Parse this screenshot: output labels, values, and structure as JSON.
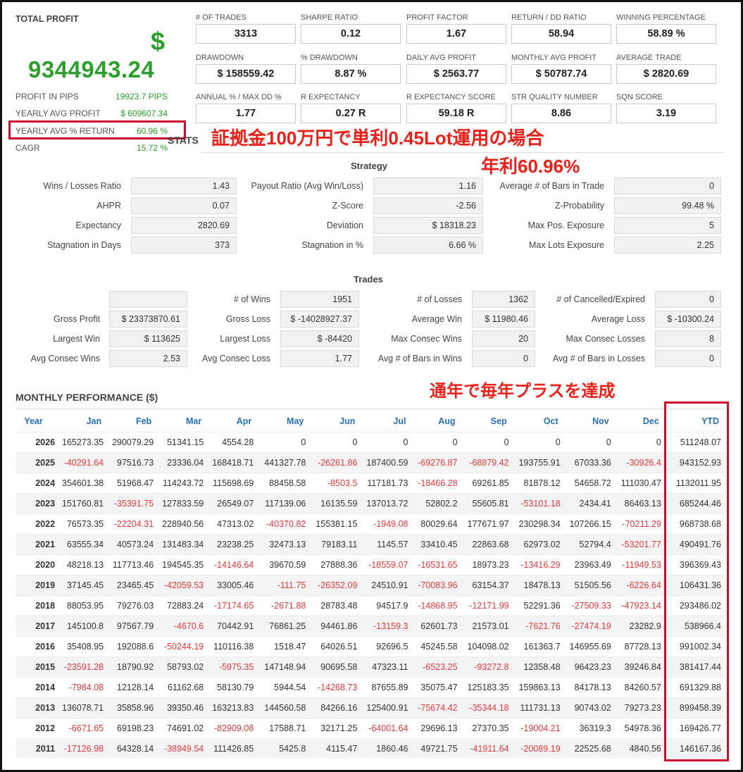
{
  "total_profit": {
    "title": "TOTAL PROFIT",
    "currency": "$",
    "value": "9344943.24",
    "rows": [
      {
        "label": "PROFIT IN PIPS",
        "value": "19923.7 PIPS"
      },
      {
        "label": "YEARLY AVG PROFIT",
        "value": "$ 609607.34"
      },
      {
        "label": "YEARLY AVG % RETURN",
        "value": "60.96 %"
      },
      {
        "label": "CAGR",
        "value": "15.72 %"
      }
    ]
  },
  "metrics": [
    {
      "label": "# OF TRADES",
      "value": "3313"
    },
    {
      "label": "SHARPE RATIO",
      "value": "0.12"
    },
    {
      "label": "PROFIT FACTOR",
      "value": "1.67"
    },
    {
      "label": "RETURN / DD RATIO",
      "value": "58.94"
    },
    {
      "label": "WINNING PERCENTAGE",
      "value": "58.89 %"
    },
    {
      "label": "DRAWDOWN",
      "value": "$ 158559.42"
    },
    {
      "label": "% DRAWDOWN",
      "value": "8.87 %"
    },
    {
      "label": "DAILY AVG PROFIT",
      "value": "$ 2563.77"
    },
    {
      "label": "MONTHLY AVG PROFIT",
      "value": "$ 50787.74"
    },
    {
      "label": "AVERAGE TRADE",
      "value": "$ 2820.69"
    },
    {
      "label": "ANNUAL % / MAX DD %",
      "value": "1.77"
    },
    {
      "label": "R EXPECTANCY",
      "value": "0.27 R"
    },
    {
      "label": "R EXPECTANCY SCORE",
      "value": "59.18 R"
    },
    {
      "label": "STR QUALITY NUMBER",
      "value": "8.86"
    },
    {
      "label": "SQN SCORE",
      "value": "3.19"
    }
  ],
  "stats_tag": "STATS",
  "annotations": {
    "margin_note": "証拠金100万円で単利0.45Lot運用の場合",
    "yearly_note": "年利60.96%",
    "every_year_note": "通年で毎年プラスを達成"
  },
  "strategy": {
    "title": "Strategy",
    "rows": [
      [
        {
          "label": "Wins / Losses Ratio",
          "value": "1.43"
        },
        {
          "label": "Payout Ratio (Avg Win/Loss)",
          "value": "1.16"
        },
        {
          "label": "Average # of Bars in Trade",
          "value": "0"
        }
      ],
      [
        {
          "label": "AHPR",
          "value": "0.07"
        },
        {
          "label": "Z-Score",
          "value": "-2.56"
        },
        {
          "label": "Z-Probability",
          "value": "99.48 %"
        }
      ],
      [
        {
          "label": "Expectancy",
          "value": "2820.69"
        },
        {
          "label": "Deviation",
          "value": "$ 18318.23"
        },
        {
          "label": "Max Pos. Exposure",
          "value": "5"
        }
      ],
      [
        {
          "label": "Stagnation in Days",
          "value": "373"
        },
        {
          "label": "Stagnation in %",
          "value": "6.66 %"
        },
        {
          "label": "Max Lots Exposure",
          "value": "2.25"
        }
      ]
    ]
  },
  "trades": {
    "title": "Trades",
    "rows": [
      [
        {
          "label": "",
          "value": ""
        },
        {
          "label": "# of Wins",
          "value": "1951"
        },
        {
          "label": "# of Losses",
          "value": "1362"
        },
        {
          "label": "# of Cancelled/Expired",
          "value": "0"
        }
      ],
      [
        {
          "label": "Gross Profit",
          "value": "$ 23373870.61"
        },
        {
          "label": "Gross Loss",
          "value": "$ -14028927.37"
        },
        {
          "label": "Average Win",
          "value": "$ 11980.46"
        },
        {
          "label": "Average Loss",
          "value": "$ -10300.24"
        }
      ],
      [
        {
          "label": "Largest Win",
          "value": "$ 113625"
        },
        {
          "label": "Largest Loss",
          "value": "$ -84420"
        },
        {
          "label": "Max Consec Wins",
          "value": "20"
        },
        {
          "label": "Max Consec Losses",
          "value": "8"
        }
      ],
      [
        {
          "label": "Avg Consec Wins",
          "value": "2.53"
        },
        {
          "label": "Avg Consec Loss",
          "value": "1.77"
        },
        {
          "label": "Avg # of Bars in Wins",
          "value": "0"
        },
        {
          "label": "Avg # of Bars in Losses",
          "value": "0"
        }
      ]
    ]
  },
  "monthly": {
    "title": "MONTHLY PERFORMANCE ($)",
    "headers": [
      "Year",
      "Jan",
      "Feb",
      "Mar",
      "Apr",
      "May",
      "Jun",
      "Jul",
      "Aug",
      "Sep",
      "Oct",
      "Nov",
      "Dec",
      "YTD"
    ],
    "rows": [
      [
        "2026",
        "165273.35",
        "290079.29",
        "51341.15",
        "4554.28",
        "0",
        "0",
        "0",
        "0",
        "0",
        "0",
        "0",
        "0",
        "511248.07"
      ],
      [
        "2025",
        "-40291.64",
        "97516.73",
        "23336.04",
        "168418.71",
        "441327.78",
        "-26261.86",
        "187400.59",
        "-69276.87",
        "-68879.42",
        "193755.91",
        "67033.36",
        "-30926.4",
        "943152.93"
      ],
      [
        "2024",
        "354601.38",
        "51968.47",
        "114243.72",
        "115698.69",
        "88458.58",
        "-8503.5",
        "117181.73",
        "-18466.28",
        "69261.85",
        "81878.12",
        "54658.72",
        "111030.47",
        "1132011.95"
      ],
      [
        "2023",
        "151760.81",
        "-35391.75",
        "127833.59",
        "26549.07",
        "117139.06",
        "16135.59",
        "137013.72",
        "52802.2",
        "55605.81",
        "-53101.18",
        "2434.41",
        "86463.13",
        "685244.46"
      ],
      [
        "2022",
        "76573.35",
        "-22204.31",
        "228940.56",
        "47313.02",
        "-40370.82",
        "155381.15",
        "-1949.08",
        "80029.64",
        "177671.97",
        "230298.34",
        "107266.15",
        "-70211.29",
        "968738.68"
      ],
      [
        "2021",
        "63555.34",
        "40573.24",
        "131483.34",
        "23238.25",
        "32473.13",
        "79183.11",
        "1145.57",
        "33410.45",
        "22863.68",
        "62973.02",
        "52794.4",
        "-53201.77",
        "490491.76"
      ],
      [
        "2020",
        "48218.13",
        "117713.46",
        "194545.35",
        "-14146.64",
        "39670.59",
        "27888.36",
        "-18559.07",
        "-16531.65",
        "18973.23",
        "-13416.29",
        "23963.49",
        "-11949.53",
        "396369.43"
      ],
      [
        "2019",
        "37145.45",
        "23465.45",
        "-42059.53",
        "33005.46",
        "-111.75",
        "-26352.09",
        "24510.91",
        "-70083.96",
        "63154.37",
        "18478.13",
        "51505.56",
        "-6226.64",
        "106431.36"
      ],
      [
        "2018",
        "88053.95",
        "79276.03",
        "72883.24",
        "-17174.65",
        "-2671.88",
        "28783.48",
        "94517.9",
        "-14868.95",
        "-12171.99",
        "52291.36",
        "-27509.33",
        "-47923.14",
        "293486.02"
      ],
      [
        "2017",
        "145100.8",
        "97567.79",
        "-4670.6",
        "70442.91",
        "76861.25",
        "94461.86",
        "-13159.3",
        "62601.73",
        "21573.01",
        "-7621.76",
        "-27474.19",
        "23282.9",
        "538966.4"
      ],
      [
        "2016",
        "35408.95",
        "192088.6",
        "-50244.19",
        "110116.38",
        "1518.47",
        "64026.51",
        "92696.5",
        "45245.58",
        "104098.02",
        "161363.7",
        "146955.69",
        "87728.13",
        "991002.34"
      ],
      [
        "2015",
        "-23591.28",
        "18790.92",
        "58793.02",
        "-5975.35",
        "147148.94",
        "90695.58",
        "47323.11",
        "-6523.25",
        "-93272.8",
        "12358.48",
        "96423.23",
        "39246.84",
        "381417.44"
      ],
      [
        "2014",
        "-7984.08",
        "12128.14",
        "61162.68",
        "58130.79",
        "5944.54",
        "-14268.73",
        "87655.89",
        "35075.47",
        "125183.35",
        "159863.13",
        "84178.13",
        "84260.57",
        "691329.88"
      ],
      [
        "2013",
        "136078.71",
        "35858.96",
        "39350.46",
        "163213.83",
        "144560.58",
        "84266.16",
        "125400.91",
        "-75674.42",
        "-35344.18",
        "111731.13",
        "90743.02",
        "79273.23",
        "899458.39"
      ],
      [
        "2012",
        "-6671.65",
        "69198.23",
        "74691.02",
        "-82909.08",
        "17588.71",
        "32171.25",
        "-64001.64",
        "29696.13",
        "27370.35",
        "-19004.21",
        "36319.3",
        "54978.36",
        "169426.77"
      ],
      [
        "2011",
        "-17126.98",
        "64328.14",
        "-38949.54",
        "111426.85",
        "5425.8",
        "4115.47",
        "1860.46",
        "49721.75",
        "-41911.64",
        "-20089.19",
        "22525.68",
        "4840.56",
        "146167.36"
      ]
    ]
  },
  "colors": {
    "positive": "#2e9e2e",
    "negative": "#e23b3b",
    "highlight": "#c8102e",
    "header_link": "#2a6fb5"
  }
}
